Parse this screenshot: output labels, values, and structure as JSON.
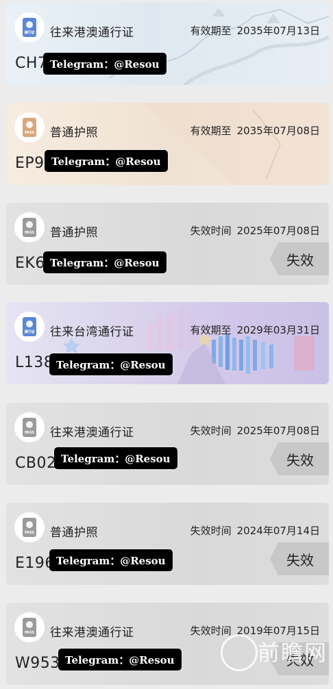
{
  "cards": [
    {
      "title": "往来港澳通行证",
      "validity_label": "有效期至",
      "date": "2035年07月13日",
      "number": "CH7",
      "watermark": "Telegram：@Resou",
      "icon_label": "通行证",
      "icon": "hk-macau-permit-icon",
      "status": ""
    },
    {
      "title": "普通护照",
      "validity_label": "有效期至",
      "date": "2035年07月08日",
      "number": "EP9",
      "watermark": "Telegram：@Resou",
      "icon_label": "PASS",
      "icon": "passport-icon",
      "status": ""
    },
    {
      "title": "普通护照",
      "validity_label": "失效时间",
      "date": "2025年07月08日",
      "number": "EK6",
      "watermark": "Telegram：@Resou",
      "icon_label": "PASS",
      "icon": "passport-icon",
      "status": "失效"
    },
    {
      "title": "往来台湾通行证",
      "validity_label": "有效期至",
      "date": "2029年03月31日",
      "number": "L138",
      "watermark": "Telegram：@Resou",
      "icon_label": "通行证",
      "icon": "taiwan-permit-icon",
      "status": ""
    },
    {
      "title": "往来港澳通行证",
      "validity_label": "失效时间",
      "date": "2025年07月08日",
      "number": "CB02",
      "watermark": "Telegram：@Resou",
      "icon_label": "PASS",
      "icon": "passport-icon",
      "status": "失效"
    },
    {
      "title": "普通护照",
      "validity_label": "失效时间",
      "date": "2024年07月14日",
      "number": "E196",
      "watermark": "Telegram：@Resou",
      "icon_label": "PASS",
      "icon": "passport-icon",
      "status": "失效"
    },
    {
      "title": "往来港澳通行证",
      "validity_label": "失效时间",
      "date": "2019年07月15日",
      "number": "W953",
      "watermark": "Telegram：@Resou",
      "icon_label": "PASS",
      "icon": "passport-icon",
      "status": "失效"
    }
  ],
  "site_watermark": "前瞻网",
  "colors": {
    "icon_blue": "#5a87d6",
    "icon_tan": "#d9a77c",
    "icon_gray": "#9a9a9a",
    "expired_tag": "#c8c8c8"
  }
}
